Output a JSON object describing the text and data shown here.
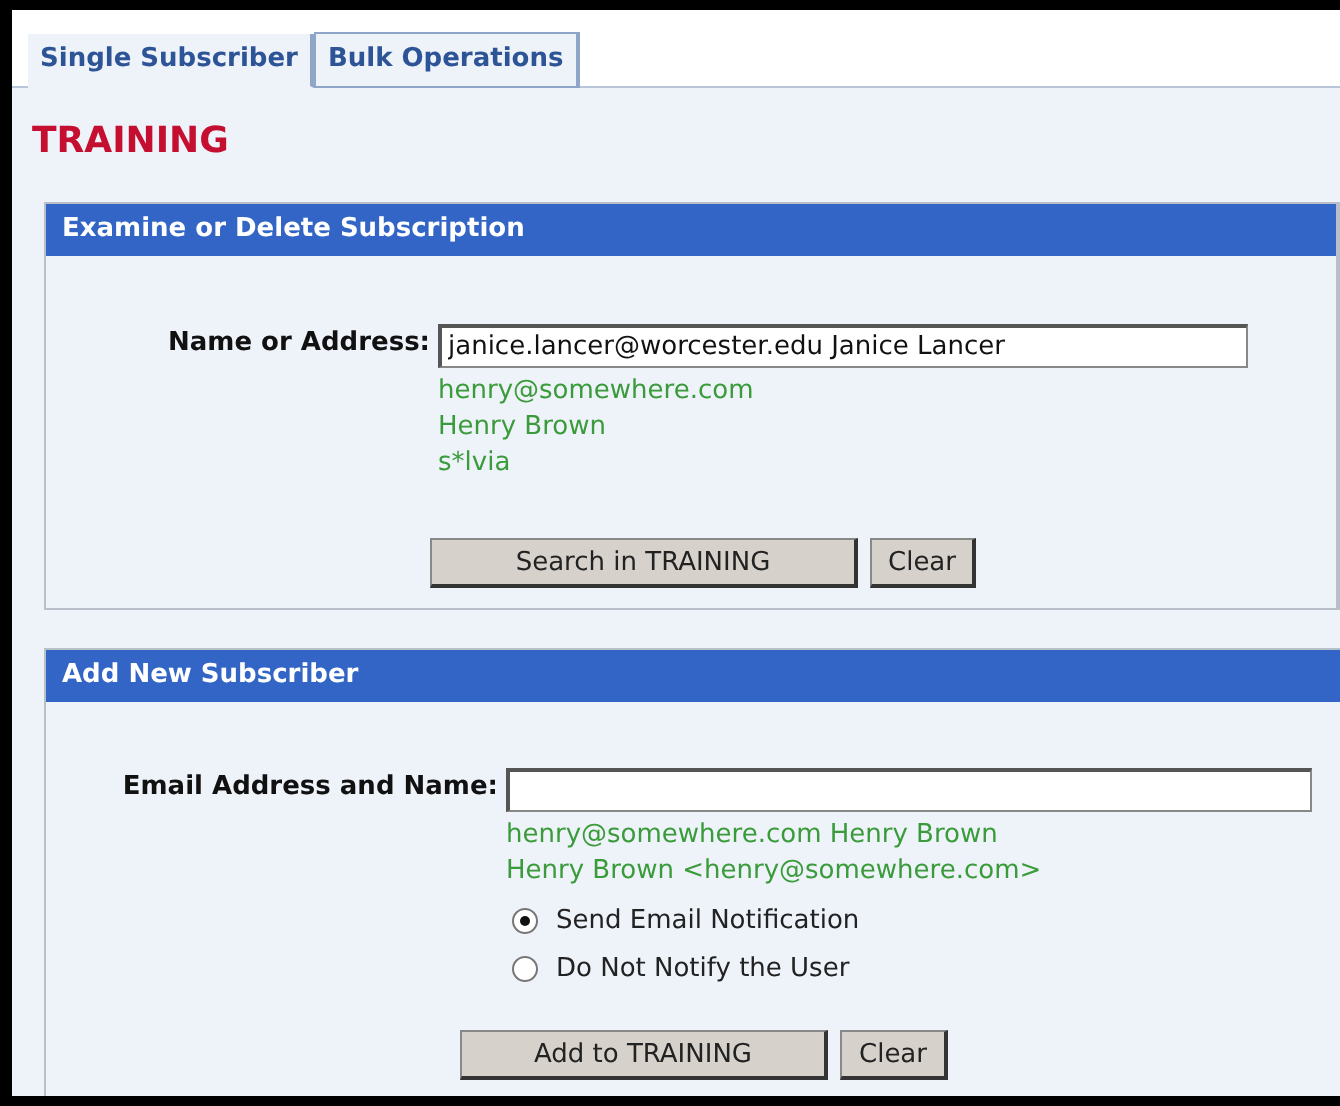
{
  "tabs": [
    {
      "label": "Single Subscriber",
      "selected": true
    },
    {
      "label": "Bulk Operations",
      "selected": false
    }
  ],
  "title": "TRAINING",
  "sections": [
    {
      "heading": "Examine or Delete Subscription",
      "field_label": "Name or Address:",
      "field_value": "janice.lancer@worcester.edu Janice Lancer",
      "hints": [
        "henry@somewhere.com",
        "Henry Brown",
        "s*lvia"
      ],
      "buttons": [
        {
          "label": "Search in TRAINING",
          "kind": "primary"
        },
        {
          "label": "Clear",
          "kind": "secondary"
        }
      ]
    },
    {
      "heading": "Add New Subscriber",
      "field_label": "Email Address and Name:",
      "hints": [
        "henry@somewhere.com Henry Brown",
        "Henry Brown <henry@somewhere.com>"
      ],
      "options": [
        {
          "label": "Send Email Notification",
          "selected": true
        },
        {
          "label": "Do Not Notify the User",
          "selected": false
        }
      ],
      "buttons": [
        {
          "label": "Add to TRAINING",
          "kind": "primary"
        },
        {
          "label": "Clear",
          "kind": "secondary"
        }
      ]
    }
  ]
}
